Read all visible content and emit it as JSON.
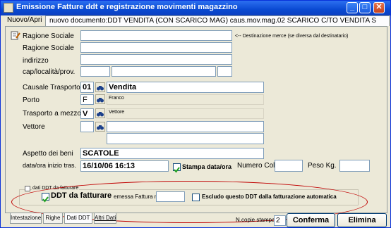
{
  "window": {
    "title": "Emissione Fatture ddt e registrazione movimenti magazzino",
    "min_label": "_",
    "max_label": "□",
    "close_label": "✕"
  },
  "top_tabs": {
    "tab1": "Nuovo/Apri",
    "tab2": "nuovo documento:DDT VENDITA (CON SCARICO MAG) caus.mov.mag.02 SCARICO C/TO VENDITA S"
  },
  "form": {
    "ragione_sociale_label_1": "Ragione Sociale",
    "ragione_sociale_label_2": "Ragione Sociale",
    "indirizzo_label": "indirizzo",
    "cap_label": "cap/località/prov.",
    "destinazione_note": "<-- Destinazione merce (se diversa dal destinatario)",
    "causale_label": "Causale Trasporto",
    "causale_code": "01",
    "causale_desc": "Vendita",
    "porto_label": "Porto",
    "porto_code": "F",
    "porto_desc": "Franco",
    "trasporto_label": "Trasporto a mezzo",
    "trasporto_code": "V",
    "trasporto_desc": "Vettore",
    "vettore_label": "Vettore",
    "aspetto_label": "Aspetto dei beni",
    "aspetto_value": "SCATOLE",
    "data_label": "data/ora inizio tras.",
    "data_value": "16/10/06 16:13",
    "stampa_label": "Stampa data/ora",
    "numero_colli_label": "Numero Colli",
    "peso_label": "Peso Kg."
  },
  "fatturare_group": {
    "title": "dati DDT da fatturare",
    "ddt_label": "DDT da fatturare",
    "emessa_label": "emessa Fattura n.",
    "escludo_label": "Escludo questo DDT dalla fatturazione automatica"
  },
  "bottom_tabs": [
    "Intestazione",
    "Righe",
    "Dati DDT",
    "Altri Dati"
  ],
  "footer": {
    "copie_label": "N.copie stampa",
    "copie_value": "2",
    "conferma_label": "Conferma",
    "elimina_label": "Elimina"
  },
  "colors": {
    "titlebar": "#0a4ad2",
    "annotation": "#c00000",
    "window_bg": "#ece9d8"
  }
}
